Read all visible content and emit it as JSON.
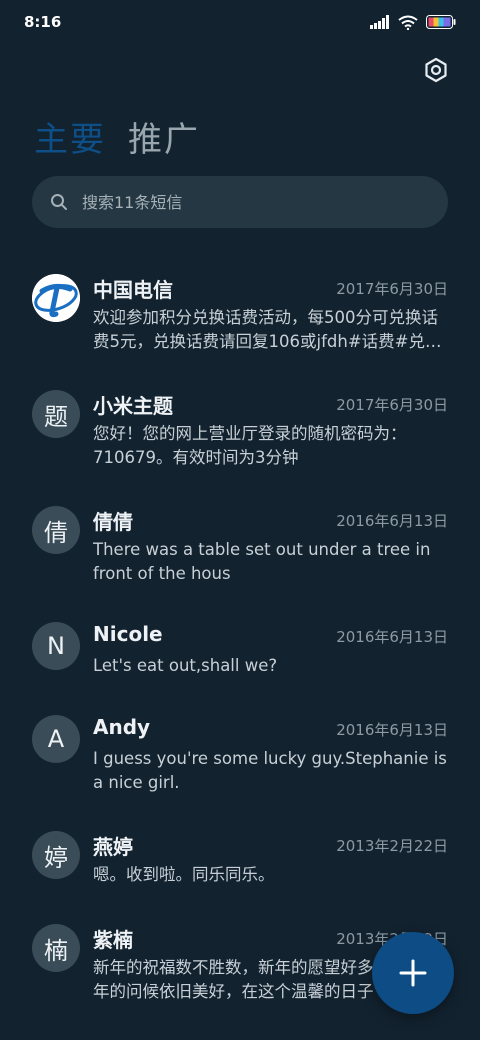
{
  "status_bar": {
    "time": "8:16"
  },
  "tabs": [
    {
      "label": "主要",
      "active": true
    },
    {
      "label": "推广",
      "active": false
    }
  ],
  "search": {
    "placeholder": "搜索11条短信"
  },
  "messages": [
    {
      "avatar": "",
      "avatar_type": "telecom-logo",
      "name": "中国电信",
      "date": "2017年6月30日",
      "preview": "欢迎参加积分兑换话费活动，每500分可兑换话费5元，兑换话费请回复106或jfdh#话费#兑换金额，详情请咨询"
    },
    {
      "avatar": "题",
      "name": "小米主题",
      "date": "2017年6月30日",
      "preview": "您好！您的网上营业厅登录的随机密码为：710679。有效时间为3分钟"
    },
    {
      "avatar": "倩",
      "name": "倩倩",
      "date": "2016年6月13日",
      "preview": "There was a table set out under a tree in front of the hous"
    },
    {
      "avatar": "N",
      "name": "Nicole",
      "date": "2016年6月13日",
      "preview": "Let's eat out,shall we?"
    },
    {
      "avatar": "A",
      "name": "Andy",
      "date": "2016年6月13日",
      "preview": "I guess you're some lucky guy.Stephanie is a nice girl."
    },
    {
      "avatar": "婷",
      "name": "燕婷",
      "date": "2013年2月22日",
      "preview": "嗯。收到啦。同乐同乐。"
    },
    {
      "avatar": "楠",
      "name": "紫楠",
      "date": "2013年2月22日",
      "preview": "新年的祝福数不胜数，新年的愿望好多好多，新年的问候依旧美好，在这个温馨的日子"
    }
  ],
  "colors": {
    "background": "#12222f",
    "accent": "#0d4c84",
    "search_bg": "#243743"
  },
  "icons": {
    "settings": "hexagon-settings-icon",
    "search": "search-icon",
    "compose": "plus-icon"
  }
}
